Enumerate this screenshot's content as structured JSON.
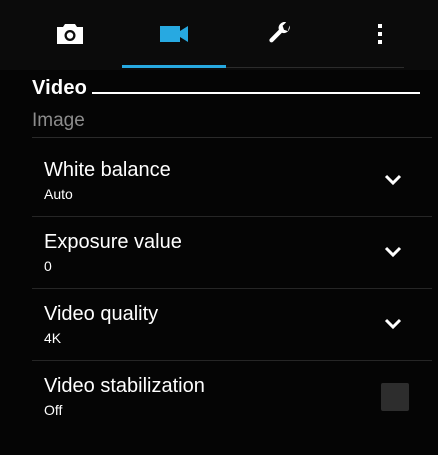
{
  "tabs": {
    "camera_icon": "camera-icon",
    "video_icon": "video-camera-icon",
    "tools_icon": "wrench-icon",
    "more_icon": "more-vertical-icon",
    "active": "video",
    "accent_color": "#27a9e1"
  },
  "section": {
    "title": "Video"
  },
  "category": {
    "label": "Image"
  },
  "settings": [
    {
      "title": "White balance",
      "value": "Auto",
      "control": "dropdown"
    },
    {
      "title": "Exposure value",
      "value": "0",
      "control": "dropdown"
    },
    {
      "title": "Video quality",
      "value": "4K",
      "control": "dropdown"
    },
    {
      "title": "Video stabilization",
      "value": "Off",
      "control": "checkbox",
      "checked": false
    }
  ]
}
